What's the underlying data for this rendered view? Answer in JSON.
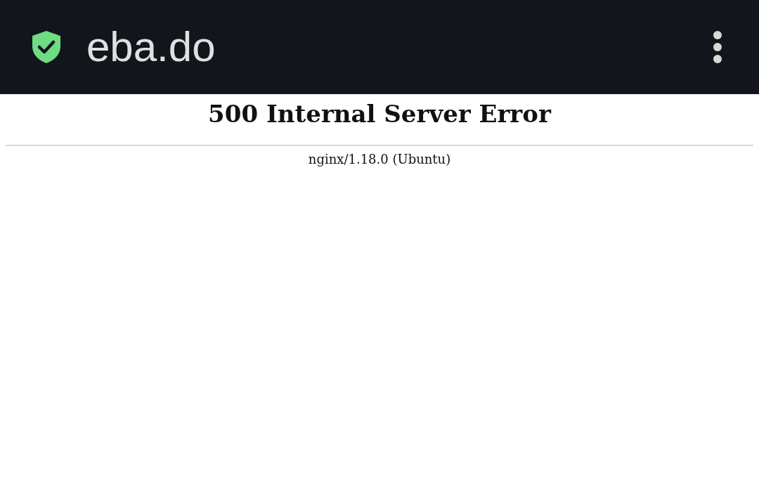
{
  "toolbar": {
    "url": "eba.do"
  },
  "page": {
    "heading": "500 Internal Server Error",
    "footer": "nginx/1.18.0 (Ubuntu)"
  }
}
